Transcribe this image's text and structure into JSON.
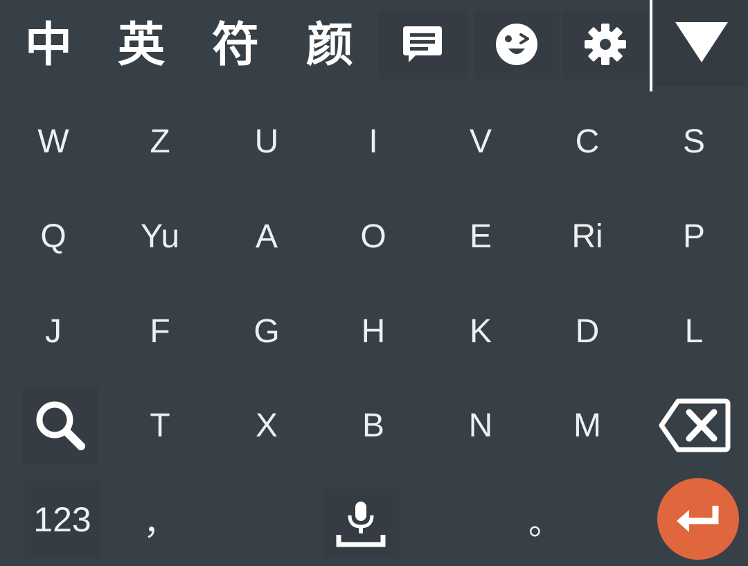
{
  "toolbar": {
    "modes": [
      {
        "label": "中",
        "name": "mode-chinese"
      },
      {
        "label": "英",
        "name": "mode-english"
      },
      {
        "label": "符",
        "name": "mode-symbols"
      },
      {
        "label": "颜",
        "name": "mode-kaomoji"
      }
    ],
    "icons": [
      "clipboard-icon",
      "emoji-icon",
      "gear-icon",
      "collapse-keyboard-icon"
    ]
  },
  "rows": [
    [
      "W",
      "Z",
      "U",
      "I",
      "V",
      "C",
      "S"
    ],
    [
      "Q",
      "Yu",
      "A",
      "O",
      "E",
      "Ri",
      "P"
    ],
    [
      "J",
      "F",
      "G",
      "H",
      "K",
      "D",
      "L"
    ],
    [
      "T",
      "X",
      "B",
      "N",
      "M"
    ]
  ],
  "bottom": {
    "numbers_label": "123",
    "comma_label": "，",
    "period_label": "。"
  },
  "colors": {
    "background": "#384047",
    "key_text": "#eef0f2",
    "enter_accent": "#e0663d"
  }
}
